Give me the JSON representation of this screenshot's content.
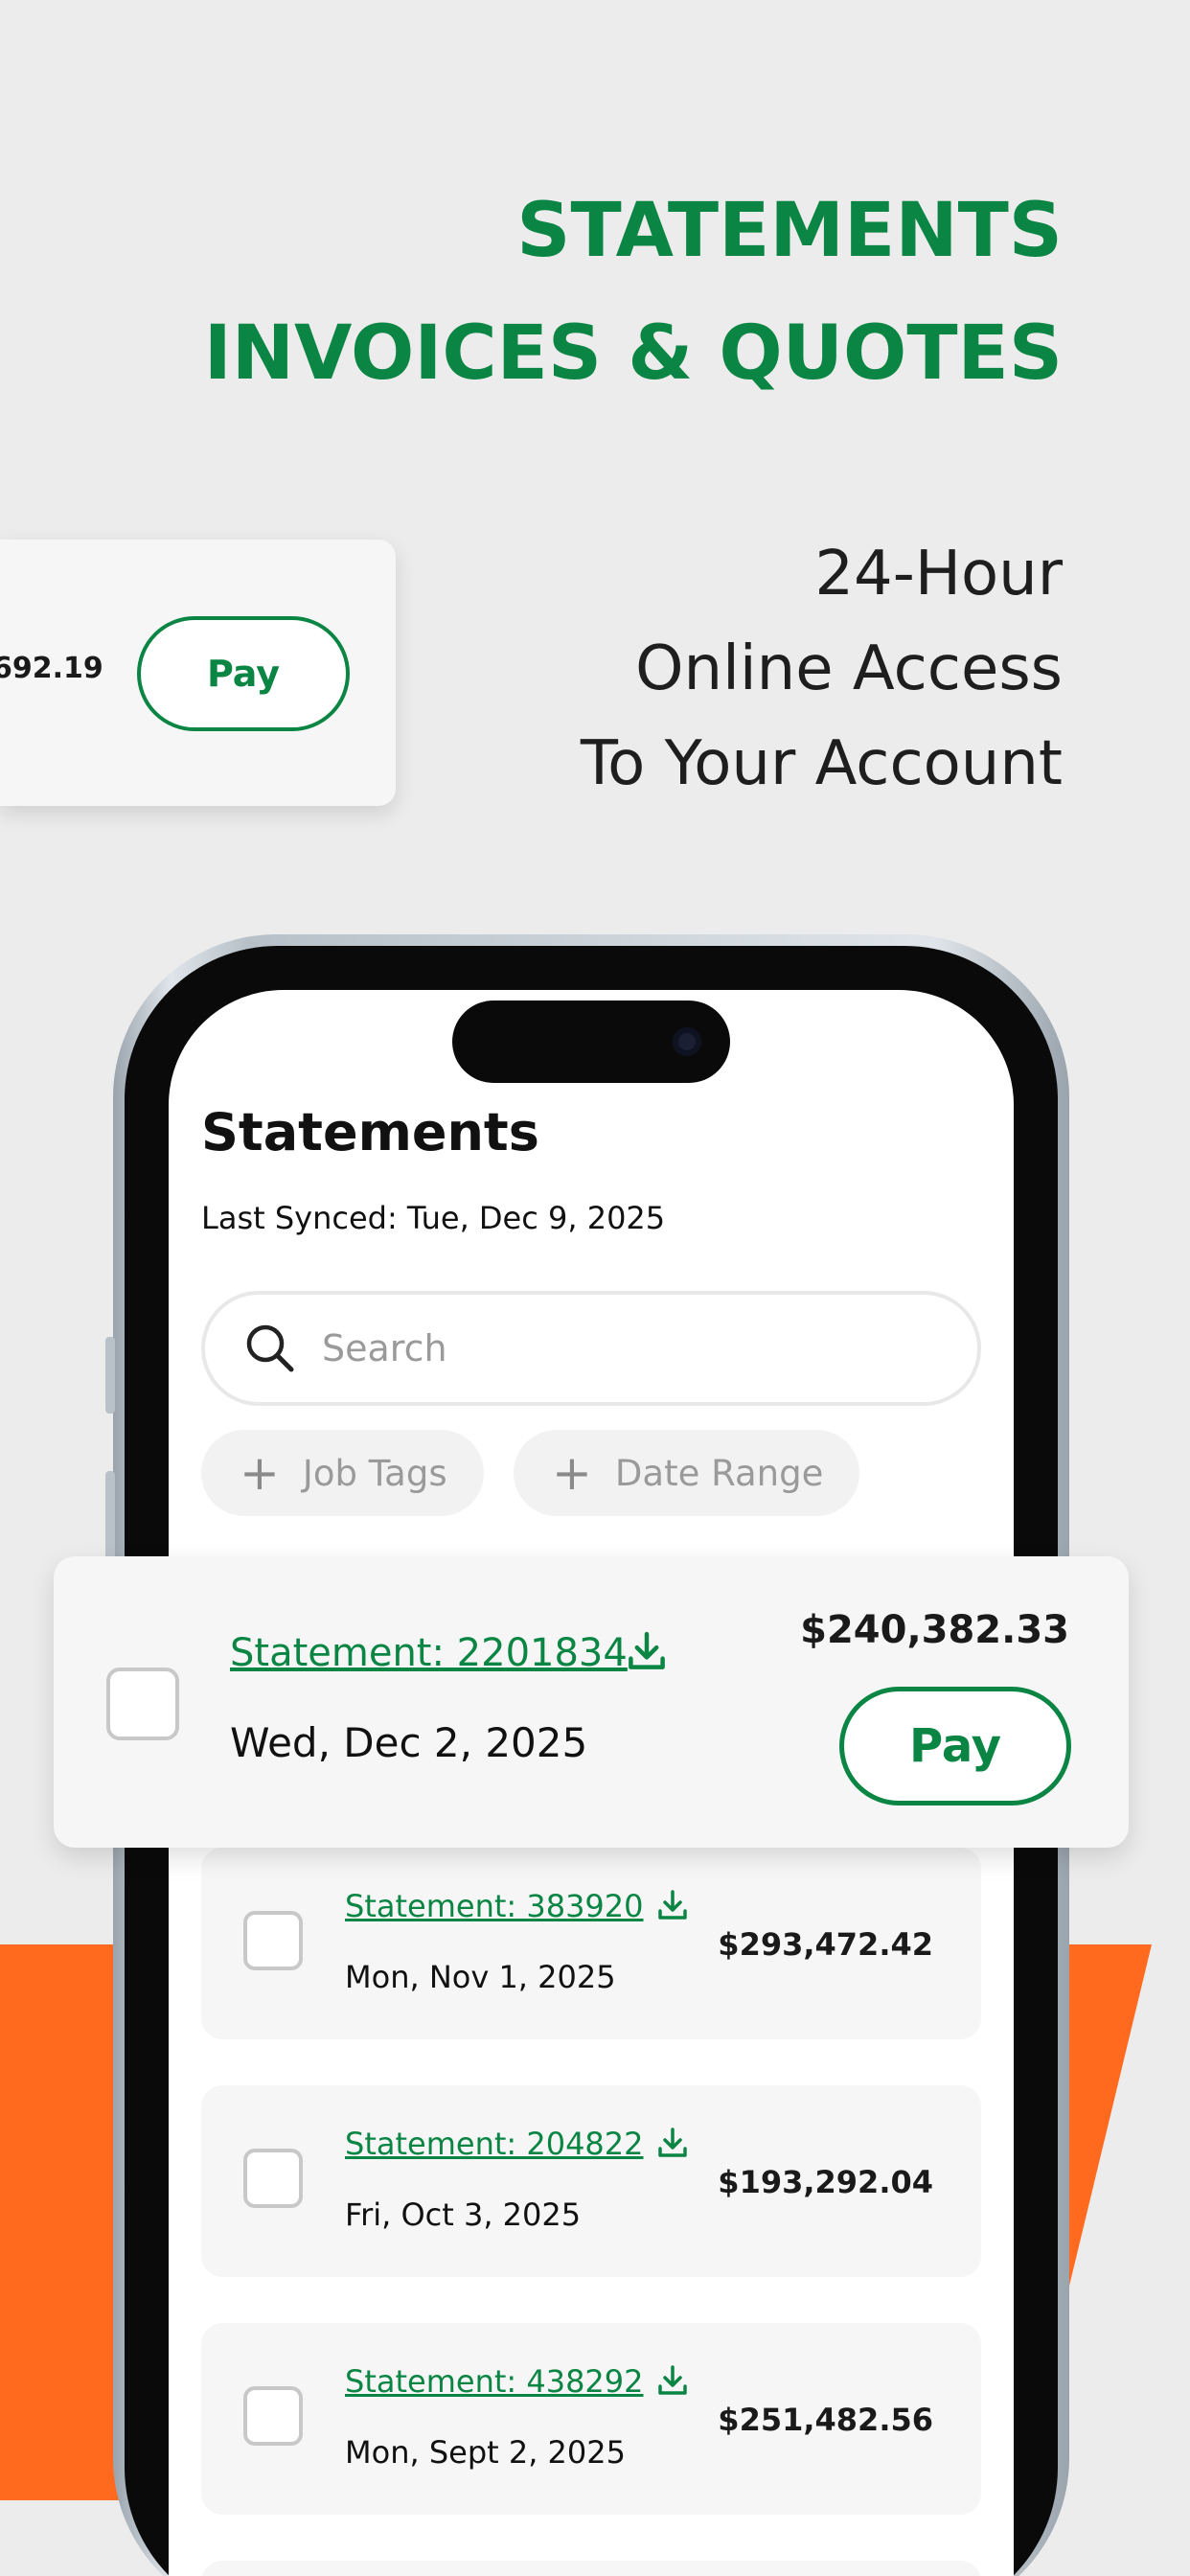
{
  "headline": {
    "line1": "STATEMENTS",
    "line2": "INVOICES & QUOTES"
  },
  "tagline": {
    "line1": "24-Hour",
    "line2": "Online Access",
    "line3": "To Your Account"
  },
  "mini_card": {
    "amount": "692.19",
    "pay_label": "Pay"
  },
  "screen": {
    "title": "Statements",
    "last_synced": "Last Synced: Tue, Dec 9, 2025",
    "search": {
      "placeholder": "Search"
    },
    "filters": [
      {
        "label": "Job Tags"
      },
      {
        "label": "Date Range"
      }
    ]
  },
  "featured_statement": {
    "link": "Statement: 2201834",
    "date": "Wed, Dec 2, 2025",
    "amount": "$240,382.33",
    "pay_label": "Pay"
  },
  "statements": [
    {
      "link": "Statement: 383920",
      "date": "Mon, Nov 1, 2025",
      "amount": "$293,472.42"
    },
    {
      "link": "Statement: 204822",
      "date": "Fri, Oct 3, 2025",
      "amount": "$193,292.04"
    },
    {
      "link": "Statement: 438292",
      "date": "Mon, Sept 2, 2025",
      "amount": "$251,482.56"
    }
  ],
  "colors": {
    "brand_green": "#0b8543",
    "accent_orange": "#ff6a1f",
    "background": "#ececec"
  }
}
